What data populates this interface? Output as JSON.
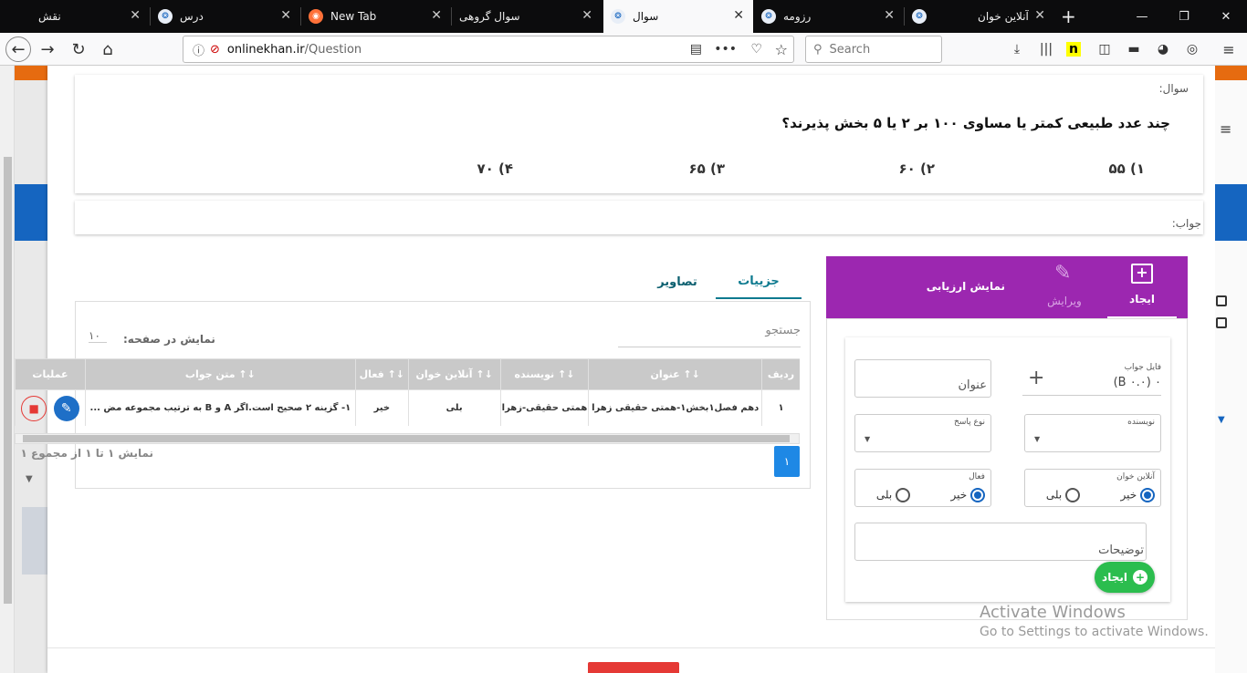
{
  "browser": {
    "tabs": [
      {
        "label": "نقش",
        "active": false
      },
      {
        "label": "درس",
        "active": false
      },
      {
        "label": "New Tab",
        "active": false
      },
      {
        "label": "سوال گروهی",
        "active": false
      },
      {
        "label": "سوال",
        "active": true
      },
      {
        "label": "رزومه",
        "active": false
      },
      {
        "label": "آنلاین خوان",
        "active": false
      }
    ],
    "url_host": "onlinekhan.ir",
    "url_path": "/Question",
    "search_placeholder": "Search"
  },
  "question": {
    "label": "سوال:",
    "text": "چند عدد طبیعی کمتر یا مساوی ۱۰۰ بر ۲ یا ۵ بخش پذیرند؟",
    "options": [
      "۱)   ۵۵",
      "۲)   ۶۰",
      "۳)   ۶۵",
      "۴)   ۷۰"
    ]
  },
  "answer": {
    "label": "جواب:"
  },
  "tabs": {
    "details": "جزییات",
    "images": "تصاویر"
  },
  "table": {
    "search_label": "جستجو",
    "page_size_label": "نمایش در صفحه:",
    "page_size_value": "۱۰",
    "headers": [
      "ردیف",
      "عنوان",
      "نویسنده",
      "آنلاین خوان",
      "فعال",
      "متن جواب",
      "عملیات"
    ],
    "rows": [
      {
        "index": "۱",
        "title": "دهم فصل۱بخش۱-همتی حقیقی زهرا",
        "author": "همتی حقیقی-زهرا",
        "online": "بلی",
        "active": "خیر",
        "answer_text": "۱- گزینه ۲ صحیح است.اگر A و B به ترتیب مجموعه مض ..."
      }
    ],
    "footer": "نمایش ۱ تا ۱ از مجموع ۱",
    "page_number": "۱"
  },
  "side": {
    "create_label": "ایجاد",
    "edit_label": "ویرایش",
    "evaluate_label": "نمایش ارزیابی",
    "file_label": "فایل جواب",
    "file_value": "۰ (B ۰.۰)",
    "title_placeholder": "عنوان",
    "author_label": "نویسنده",
    "answer_type_label": "نوع پاسخ",
    "online_label": "آنلاین خوان",
    "active_label": "فعال",
    "yes": "بلی",
    "no": "خیر",
    "description_placeholder": "توضیحات",
    "submit_label": "ایجاد"
  },
  "watermark": {
    "line1": "Activate Windows",
    "line2": "Go to Settings to activate Windows."
  },
  "colors": {
    "purple": "#9c27b0",
    "blue": "#1e88e5",
    "green": "#2bbd4e",
    "red": "#e53935"
  }
}
